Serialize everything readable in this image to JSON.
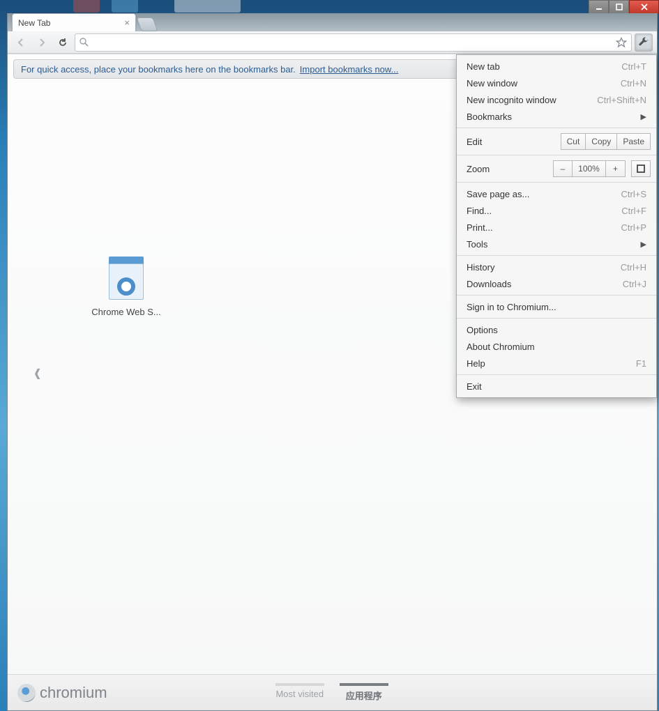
{
  "tab": {
    "title": "New Tab"
  },
  "bookmark_bar": {
    "tip": "For quick access, place your bookmarks here on the bookmarks bar.",
    "link": "Import bookmarks now..."
  },
  "app_tile": {
    "label": "Chrome Web S..."
  },
  "footer": {
    "brand": "chromium",
    "most_visited": "Most visited",
    "apps": "应用程序"
  },
  "menu": {
    "new_tab": "New tab",
    "new_tab_sc": "Ctrl+T",
    "new_window": "New window",
    "new_window_sc": "Ctrl+N",
    "incognito": "New incognito window",
    "incognito_sc": "Ctrl+Shift+N",
    "bookmarks": "Bookmarks",
    "edit": "Edit",
    "cut": "Cut",
    "copy": "Copy",
    "paste": "Paste",
    "zoom": "Zoom",
    "zoom_minus": "–",
    "zoom_val": "100%",
    "zoom_plus": "+",
    "save_as": "Save page as...",
    "save_as_sc": "Ctrl+S",
    "find": "Find...",
    "find_sc": "Ctrl+F",
    "print": "Print...",
    "print_sc": "Ctrl+P",
    "tools": "Tools",
    "history": "History",
    "history_sc": "Ctrl+H",
    "downloads": "Downloads",
    "downloads_sc": "Ctrl+J",
    "signin": "Sign in to Chromium...",
    "options": "Options",
    "about": "About Chromium",
    "help": "Help",
    "help_sc": "F1",
    "exit": "Exit"
  }
}
